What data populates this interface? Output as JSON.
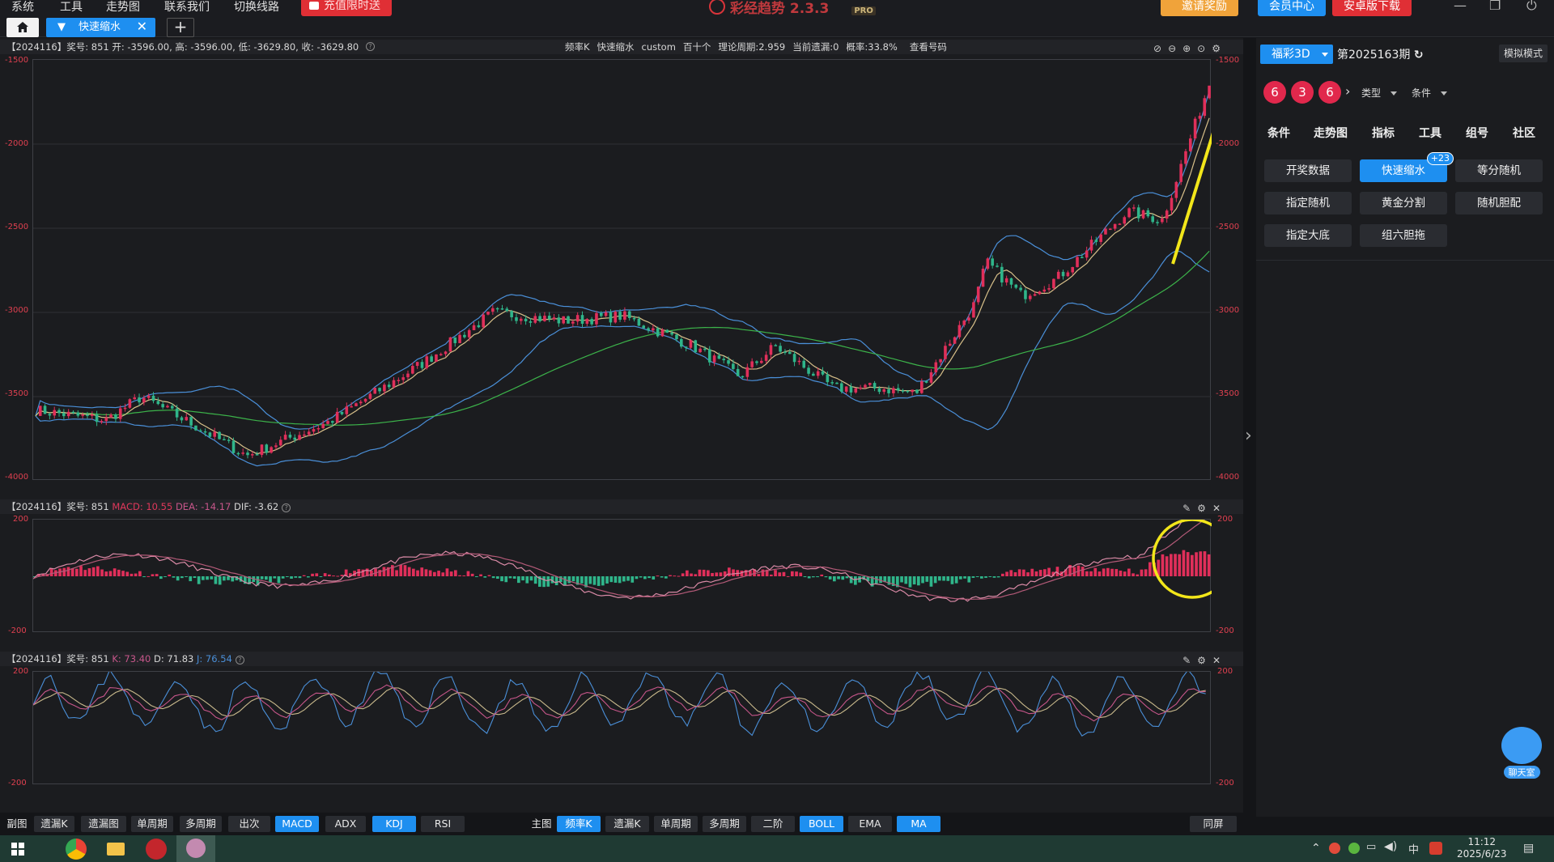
{
  "menu": [
    "系统",
    "工具",
    "走势图",
    "联系我们",
    "切换线路"
  ],
  "promo_label": "充值限时送",
  "app_name": "彩经趋势 2.3.3",
  "app_badge": "PRO",
  "top_buttons": {
    "invite": "邀请奖励",
    "member": "会员中心",
    "android": "安卓版下载"
  },
  "tab": {
    "label": "快速缩水"
  },
  "main_chart": {
    "info": "【2024116】奖号: 851  开: -3596.00, 高: -3596.00, 低: -3629.80, 收: -3629.80",
    "header_items": [
      "频率K",
      "快速缩水",
      "custom",
      "百十个",
      "理论周期:2.959",
      "当前遗漏:0",
      "概率:33.8%"
    ],
    "check_label": "查看号码",
    "yticks": [
      "-1500",
      "-2000",
      "-2500",
      "-3000",
      "-3500",
      "-4000"
    ]
  },
  "macd_panel": {
    "prefix": "【2024116】奖号: 851 ",
    "macd": "MACD: 10.55",
    "dea": "DEA: -14.17",
    "dif": "DIF: -3.62",
    "ytop": "200",
    "ybot": "-200"
  },
  "kdj_panel": {
    "prefix": "【2024116】奖号: 851 ",
    "k": "K: 73.40",
    "d": "D: 71.83",
    "j": "J: 76.54",
    "ytop": "200",
    "ybot": "-200"
  },
  "sub_toolbar": {
    "label": "副图",
    "items": [
      "遗漏K",
      "遗漏图",
      "单周期",
      "多周期",
      "出次",
      "MACD",
      "ADX",
      "KDJ",
      "RSI"
    ],
    "active": [
      "MACD",
      "KDJ"
    ]
  },
  "main_toolbar": {
    "label": "主图",
    "items": [
      "频率K",
      "遗漏K",
      "单周期",
      "多周期",
      "二阶",
      "BOLL",
      "EMA",
      "MA"
    ],
    "active": [
      "频率K",
      "BOLL",
      "MA"
    ]
  },
  "same_screen": "同屏",
  "right": {
    "lottery": "福彩3D",
    "period": "第2025163期",
    "sim_mode": "模拟模式",
    "balls": [
      "6",
      "3",
      "6"
    ],
    "dropdowns": [
      "类型",
      "条件"
    ],
    "tabs": [
      "条件",
      "走势图",
      "指标",
      "工具",
      "组号",
      "社区"
    ],
    "tools": [
      "开奖数据",
      "快速缩水",
      "等分随机",
      "指定随机",
      "黄金分割",
      "随机胆配",
      "指定大底",
      "组六胆拖"
    ],
    "active_tool": "快速缩水",
    "badge": "+23"
  },
  "chat_label": "聊天室",
  "clock": {
    "time": "11:12",
    "date": "2025/6/23"
  },
  "tray": [
    "中"
  ],
  "colors": {
    "accent": "#1e8ff0",
    "up": "#e02f5a",
    "down": "#2fb58a",
    "boll": "#4a8fd8",
    "ma_slow": "#3cb34a",
    "ma_fast": "#d8c08a",
    "annotation": "#f2e61a"
  }
}
